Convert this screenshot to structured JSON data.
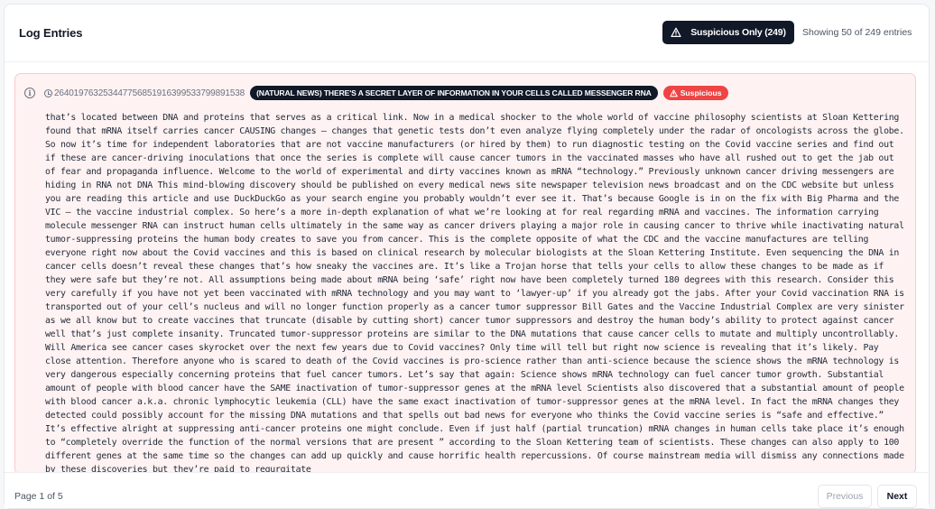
{
  "header": {
    "title": "Log Entries",
    "filter_label": "Suspicious Only (249)",
    "showing_text": "Showing 50 of 249 entries"
  },
  "entry": {
    "id": "264019763253447756851916399533799891538",
    "headline": "(NATURAL NEWS) THERE'S A SECRET LAYER OF INFORMATION IN YOUR CELLS CALLED MESSENGER RNA",
    "badge": "Suspicious",
    "text": "that’s located between DNA and proteins that serves as a critical link. Now in a medical shocker to the whole world of vaccine philosophy scientists at Sloan Kettering found that mRNA itself carries cancer CAUSING changes – changes that genetic tests don’t even analyze flying completely under the radar of oncologists across the globe. So now it’s time for independent laboratories that are not vaccine manufacturers (or hired by them) to run diagnostic testing on the Covid vaccine series and find out if these are cancer-driving inoculations that once the series is complete will cause cancer tumors in the vaccinated masses who have all rushed out to get the jab out of fear and propaganda influence. Welcome to the world of experimental and dirty vaccines known as mRNA “technology.” Previously unknown cancer driving messengers are hiding in RNA not DNA This mind-blowing discovery should be published on every medical news site newspaper television news broadcast and on the CDC website but unless you are reading this article and use DuckDuckGo as your search engine you probably wouldn’t ever see it. That’s because Google is in on the fix with Big Pharma and the VIC – the vaccine industrial complex. So here’s a more in-depth explanation of what we’re looking at for real regarding mRNA and vaccines. The information carrying molecule messenger RNA can instruct human cells ultimately in the same way as cancer drivers playing a major role in causing cancer to thrive while inactivating natural tumor-suppressing proteins the human body creates to save you from cancer. This is the complete opposite of what the CDC and the vaccine manufactures are telling everyone right now about the Covid vaccines and this is based on clinical research by molecular biologists at the Sloan Kettering Institute. Even sequencing the DNA in cancer cells doesn’t reveal these changes that’s how sneaky the vaccines are. It’s like a Trojan horse that tells your cells to allow these changes to be made as if they were safe but they’re not. All assumptions being made about mRNA being ‘safe’ right now have been completely turned 180 degrees with this research. Consider this very carefully if you have not yet been vaccinated with mRNA technology and you may want to ‘lawyer-up’ if you already got the jabs. After your Covid vaccination RNA is transported out of your cell’s nucleus and will no longer function properly as a cancer tumor suppressor Bill Gates and the Vaccine Industrial Complex are very sinister as we all know but to create vaccines that truncate (disable by cutting short) cancer tumor suppressors and destroy the human body’s ability to protect against cancer well that’s just complete insanity. Truncated tumor-suppressor proteins are similar to the DNA mutations that cause cancer cells to mutate and multiply uncontrollably. Will America see cancer cases skyrocket over the next few years due to Covid vaccines? Only time will tell but right now science is revealing that it’s likely. Pay close attention. Therefore anyone who is scared to death of the Covid vaccines is pro-science rather than anti-science because the science shows the mRNA technology is very dangerous especially concerning proteins that fuel cancer tumors. Let’s say that again: Science shows mRNA technology can fuel cancer tumor growth. Substantial amount of people with blood cancer have the SAME inactivation of tumor-suppressor genes at the mRNA level Scientists also discovered that a substantial amount of people with blood cancer a.k.a. chronic lymphocytic leukemia (CLL) have the same exact inactivation of tumor-suppressor genes at the mRNA level. In fact the mRNA changes they detected could possibly account for the missing DNA mutations and that spells out bad news for everyone who thinks the Covid vaccine series is “safe and effective.” It’s effective alright at suppressing anti-cancer proteins one might conclude. Even if just half (partial truncation) mRNA changes in human cells take place it’s enough to “completely override the function of the normal versions that are present ” according to the Sloan Kettering team of scientists. These changes can also apply to 100 different genes at the same time so the changes can add up quickly and cause horrific health repercussions. Of course mainstream media will dismiss any connections made by these discoveries but they’re paid to regurgitate"
  },
  "footer": {
    "page_text": "Page 1 of 5",
    "prev_label": "Previous",
    "next_label": "Next"
  },
  "icons": {
    "filter": "warning-triangle-icon",
    "entry_info": "info-icon",
    "timestamp": "clock-icon",
    "suspicious": "warning-triangle-icon"
  },
  "colors": {
    "dark": "#111827",
    "danger": "#ef4444",
    "entry_bg": "#fef2f2",
    "entry_border": "#fecaca"
  }
}
